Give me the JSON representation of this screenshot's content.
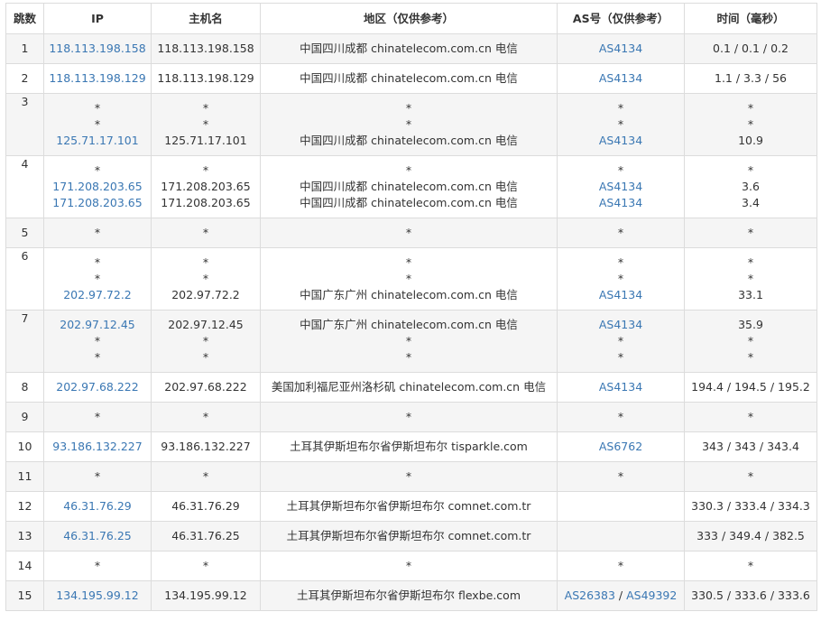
{
  "headers": [
    "跳数",
    "IP",
    "主机名",
    "地区（仅供参考）",
    "AS号（仅供参考）",
    "时间（毫秒）"
  ],
  "rows": [
    {
      "hop": "1",
      "ip": [
        "118.113.198.158"
      ],
      "host": [
        "118.113.198.158"
      ],
      "region": [
        "中国四川成都 chinatelecom.com.cn 电信"
      ],
      "as": [
        [
          "AS4134"
        ]
      ],
      "time": [
        "0.1 / 0.1 / 0.2"
      ]
    },
    {
      "hop": "2",
      "ip": [
        "118.113.198.129"
      ],
      "host": [
        "118.113.198.129"
      ],
      "region": [
        "中国四川成都 chinatelecom.com.cn 电信"
      ],
      "as": [
        [
          "AS4134"
        ]
      ],
      "time": [
        "1.1 / 3.3 / 56"
      ]
    },
    {
      "hop": "3",
      "ip": [
        "*",
        "*",
        "125.71.17.101"
      ],
      "host": [
        "*",
        "*",
        "125.71.17.101"
      ],
      "region": [
        "*",
        "*",
        "中国四川成都 chinatelecom.com.cn 电信"
      ],
      "as": [
        [
          "*"
        ],
        [
          "*"
        ],
        [
          "AS4134"
        ]
      ],
      "time": [
        "*",
        "*",
        "10.9"
      ]
    },
    {
      "hop": "4",
      "ip": [
        "*",
        "171.208.203.65",
        "171.208.203.65"
      ],
      "host": [
        "*",
        "171.208.203.65",
        "171.208.203.65"
      ],
      "region": [
        "*",
        "中国四川成都 chinatelecom.com.cn 电信",
        "中国四川成都 chinatelecom.com.cn 电信"
      ],
      "as": [
        [
          "*"
        ],
        [
          "AS4134"
        ],
        [
          "AS4134"
        ]
      ],
      "time": [
        "*",
        "3.6",
        "3.4"
      ]
    },
    {
      "hop": "5",
      "ip": [
        "*"
      ],
      "host": [
        "*"
      ],
      "region": [
        "*"
      ],
      "as": [
        [
          "*"
        ]
      ],
      "time": [
        "*"
      ]
    },
    {
      "hop": "6",
      "ip": [
        "*",
        "*",
        "202.97.72.2"
      ],
      "host": [
        "*",
        "*",
        "202.97.72.2"
      ],
      "region": [
        "*",
        "*",
        "中国广东广州 chinatelecom.com.cn 电信"
      ],
      "as": [
        [
          "*"
        ],
        [
          "*"
        ],
        [
          "AS4134"
        ]
      ],
      "time": [
        "*",
        "*",
        "33.1"
      ]
    },
    {
      "hop": "7",
      "ip": [
        "202.97.12.45",
        "*",
        "*"
      ],
      "host": [
        "202.97.12.45",
        "*",
        "*"
      ],
      "region": [
        "中国广东广州 chinatelecom.com.cn 电信",
        "*",
        "*"
      ],
      "as": [
        [
          "AS4134"
        ],
        [
          "*"
        ],
        [
          "*"
        ]
      ],
      "time": [
        "35.9",
        "*",
        "*"
      ]
    },
    {
      "hop": "8",
      "ip": [
        "202.97.68.222"
      ],
      "host": [
        "202.97.68.222"
      ],
      "region": [
        "美国加利福尼亚州洛杉矶 chinatelecom.com.cn 电信"
      ],
      "as": [
        [
          "AS4134"
        ]
      ],
      "time": [
        "194.4 / 194.5 / 195.2"
      ]
    },
    {
      "hop": "9",
      "ip": [
        "*"
      ],
      "host": [
        "*"
      ],
      "region": [
        "*"
      ],
      "as": [
        [
          "*"
        ]
      ],
      "time": [
        "*"
      ]
    },
    {
      "hop": "10",
      "ip": [
        "93.186.132.227"
      ],
      "host": [
        "93.186.132.227"
      ],
      "region": [
        "土耳其伊斯坦布尔省伊斯坦布尔 tisparkle.com"
      ],
      "as": [
        [
          "AS6762"
        ]
      ],
      "time": [
        "343 / 343 / 343.4"
      ]
    },
    {
      "hop": "11",
      "ip": [
        "*"
      ],
      "host": [
        "*"
      ],
      "region": [
        "*"
      ],
      "as": [
        [
          "*"
        ]
      ],
      "time": [
        "*"
      ]
    },
    {
      "hop": "12",
      "ip": [
        "46.31.76.29"
      ],
      "host": [
        "46.31.76.29"
      ],
      "region": [
        "土耳其伊斯坦布尔省伊斯坦布尔 comnet.com.tr"
      ],
      "as": [
        []
      ],
      "time": [
        "330.3 / 333.4 / 334.3"
      ]
    },
    {
      "hop": "13",
      "ip": [
        "46.31.76.25"
      ],
      "host": [
        "46.31.76.25"
      ],
      "region": [
        "土耳其伊斯坦布尔省伊斯坦布尔 comnet.com.tr"
      ],
      "as": [
        []
      ],
      "time": [
        "333 / 349.4 / 382.5"
      ]
    },
    {
      "hop": "14",
      "ip": [
        "*"
      ],
      "host": [
        "*"
      ],
      "region": [
        "*"
      ],
      "as": [
        [
          "*"
        ]
      ],
      "time": [
        "*"
      ]
    },
    {
      "hop": "15",
      "ip": [
        "134.195.99.12"
      ],
      "host": [
        "134.195.99.12"
      ],
      "region": [
        "土耳其伊斯坦布尔省伊斯坦布尔 flexbe.com"
      ],
      "as": [
        [
          "AS26383",
          "AS49392"
        ]
      ],
      "time": [
        "330.5 / 333.6 / 333.6"
      ]
    }
  ],
  "colors": {
    "link": "#3a77b3",
    "border": "#dcdcdc",
    "stripe": "#f5f5f5"
  }
}
